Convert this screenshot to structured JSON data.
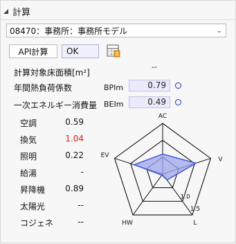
{
  "header": {
    "title": "計算"
  },
  "selector": {
    "value": "08470：事務所：事務所モデル"
  },
  "buttons": {
    "api": "API計算",
    "ok": "OK"
  },
  "area": {
    "label": "計算対象床面積[m²]",
    "value": "--"
  },
  "annual": {
    "label": "年間熱負荷係数",
    "index_label": "BPIm",
    "value": "0.79"
  },
  "primary": {
    "label": "一次エネルギー消費量",
    "index_label": "BEIm",
    "value": "0.49"
  },
  "categories": [
    {
      "label": "空調",
      "value": "0.59",
      "highlight": false
    },
    {
      "label": "換気",
      "value": "1.04",
      "highlight": true
    },
    {
      "label": "照明",
      "value": "0.22",
      "highlight": false
    },
    {
      "label": "給湯",
      "value": "-",
      "highlight": false
    },
    {
      "label": "昇降機",
      "value": "0.89",
      "highlight": false
    },
    {
      "label": "太陽光",
      "value": "--",
      "highlight": false
    },
    {
      "label": "コジェネ",
      "value": "--",
      "highlight": false
    }
  ],
  "chart_data": {
    "type": "radar",
    "axes": [
      "AC",
      "V",
      "L",
      "HW",
      "EV"
    ],
    "values": [
      0.59,
      1.04,
      0.22,
      0,
      0.89
    ],
    "range": [
      0,
      1.5
    ],
    "ring_labels": [
      "1.0",
      "1.5"
    ],
    "series_color": "#4a5bd8",
    "fill_color": "#9ea6ee"
  }
}
